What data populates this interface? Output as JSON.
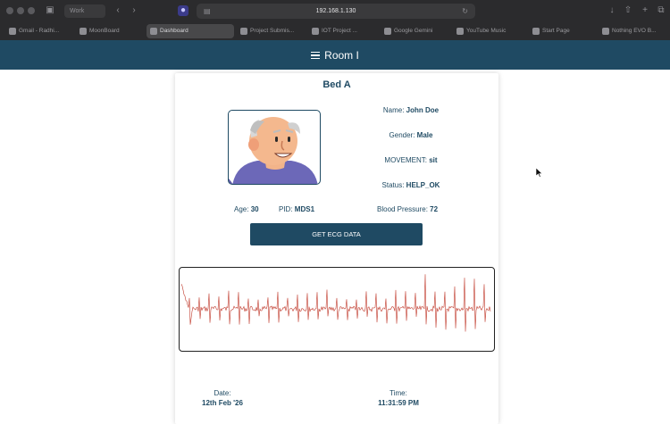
{
  "browser": {
    "url": "192.168.1.130",
    "profile_label": "Work",
    "tabs": [
      {
        "label": "Gmail - Radhi..."
      },
      {
        "label": "MoonBoard"
      },
      {
        "label": "Dashboard"
      },
      {
        "label": "Project Submis..."
      },
      {
        "label": "IOT Project ..."
      },
      {
        "label": "Google Gemini"
      },
      {
        "label": "YouTube Music"
      },
      {
        "label": "Start Page"
      },
      {
        "label": "Nothing EVO B..."
      }
    ]
  },
  "header": {
    "room_title": "Room I"
  },
  "patient": {
    "bed_title": "Bed A",
    "name_label": "Name:",
    "name": "John Doe",
    "gender_label": "Gender:",
    "gender": "Male",
    "movement_label": "MOVEMENT:",
    "movement": "sit",
    "status_label": "Status:",
    "status": "HELP_OK",
    "age_label": "Age:",
    "age": "30",
    "pid_label": "PID:",
    "pid": "MDS1",
    "bp_label": "Blood Pressure:",
    "bp": "72"
  },
  "ecg_button": {
    "label": "GET ECG DATA"
  },
  "footer": {
    "date_label": "Date:",
    "date": "12th Feb '26",
    "time_label": "Time:",
    "time": "11:31:59 PM"
  },
  "colors": {
    "primary": "#1f4a63",
    "ecg_trace": "#c0392b"
  }
}
